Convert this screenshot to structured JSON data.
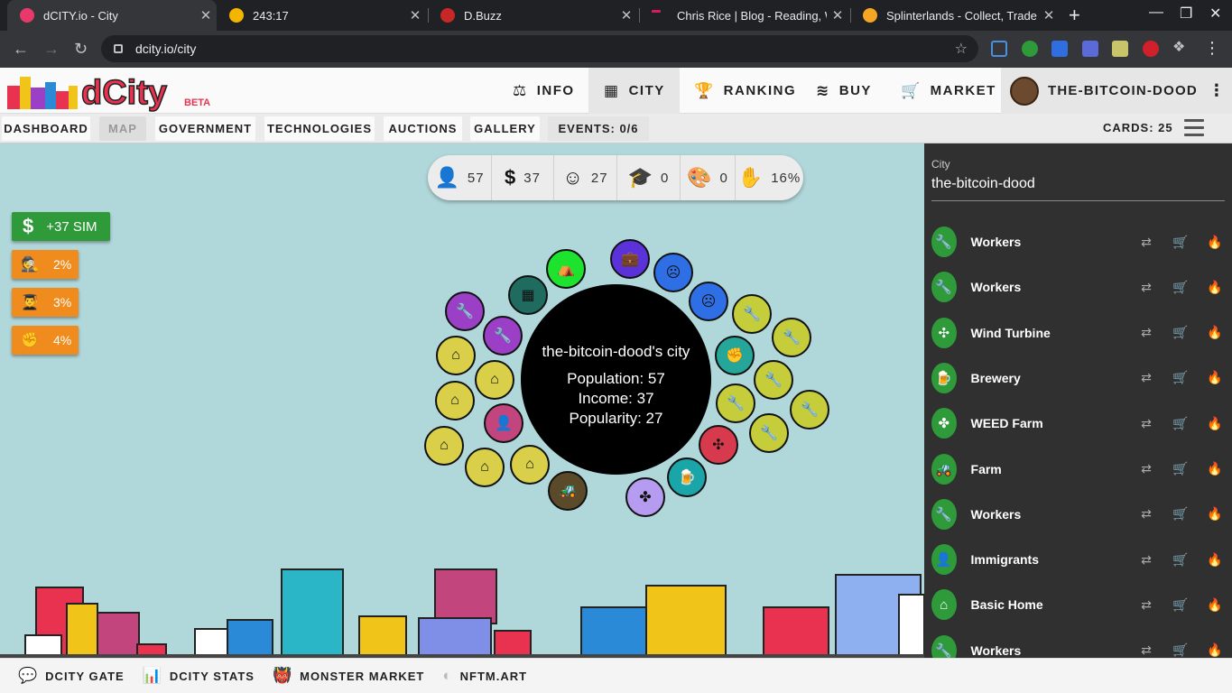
{
  "browser": {
    "tabs": [
      {
        "title": "dCITY.io - City",
        "favicon_color": "#e83a6a"
      },
      {
        "title": "243:17",
        "favicon_color": "#f4b400"
      },
      {
        "title": "D.Buzz",
        "favicon_color": "#c62828"
      },
      {
        "title": "Chris Rice | Blog - Reading, W",
        "favicon_color": "#d81b60"
      },
      {
        "title": "Splinterlands - Collect, Trade,",
        "favicon_color": "#f5a623"
      }
    ],
    "new_tab_glyph": "+",
    "close_glyph": "✕",
    "url": "dcity.io/city",
    "window_controls": [
      "—",
      "❐",
      "✕"
    ]
  },
  "header": {
    "logo_text": "dCity",
    "logo_badge": "BETA",
    "nav": [
      {
        "label": "INFO",
        "icon": "scale-icon",
        "glyph": "⚖"
      },
      {
        "label": "CITY",
        "icon": "city-icon",
        "glyph": "▦"
      },
      {
        "label": "RANKING",
        "icon": "trophy-icon",
        "glyph": "🏆"
      },
      {
        "label": "BUY",
        "icon": "layers-icon",
        "glyph": "≋"
      },
      {
        "label": "MARKET",
        "icon": "cart-icon",
        "glyph": "🛒"
      }
    ],
    "user": "THE-BITCOIN-DOOD",
    "more_glyph": "⋮"
  },
  "subnav": {
    "buttons": [
      "DASHBOARD",
      "MAP",
      "GOVERNMENT",
      "TECHNOLOGIES",
      "AUCTIONS",
      "GALLERY",
      "EVENTS: 0/6"
    ],
    "cards": "CARDS: 25"
  },
  "stats": [
    {
      "icon": "person-icon",
      "glyph": "👤",
      "value": "57"
    },
    {
      "icon": "dollar-icon",
      "glyph": "$",
      "value": "37"
    },
    {
      "icon": "smile-icon",
      "glyph": "☺",
      "value": "27"
    },
    {
      "icon": "graduation-cap-icon",
      "glyph": "🎓",
      "value": "0"
    },
    {
      "icon": "palette-icon",
      "glyph": "🎨",
      "value": "0"
    },
    {
      "icon": "hand-money-icon",
      "glyph": "✋",
      "value": "16%"
    }
  ],
  "left_panel": {
    "sim": {
      "glyph": "$",
      "label": "+37 SIM"
    },
    "percents": [
      {
        "icon": "crime-icon",
        "glyph": "🕵",
        "value": "2%"
      },
      {
        "icon": "education-icon",
        "glyph": "👨‍🎓",
        "value": "3%"
      },
      {
        "icon": "fist-icon",
        "glyph": "✊",
        "value": "4%"
      }
    ]
  },
  "city_core": {
    "title": "the-bitcoin-dood's city",
    "population": "Population: 57",
    "income": "Income: 37",
    "popularity": "Popularity: 27"
  },
  "bubbles": [
    {
      "icon": "wrench-icon",
      "glyph": "🔧",
      "color": "#9b3fc6"
    },
    {
      "icon": "wrench-icon",
      "glyph": "🔧",
      "color": "#9b3fc6"
    },
    {
      "icon": "factory-icon",
      "glyph": "▦",
      "color": "#1f6b60"
    },
    {
      "icon": "camp-icon",
      "glyph": "⛺",
      "color": "#1ee32e"
    },
    {
      "icon": "briefcase-icon",
      "glyph": "💼",
      "color": "#5b32d9"
    },
    {
      "icon": "sad-icon",
      "glyph": "☹",
      "color": "#2e6fe6"
    },
    {
      "icon": "sad-icon",
      "glyph": "☹",
      "color": "#2e6fe6"
    },
    {
      "icon": "wrench-icon",
      "glyph": "🔧",
      "color": "#c6cd3a"
    },
    {
      "icon": "wrench-icon",
      "glyph": "🔧",
      "color": "#c6cd3a"
    },
    {
      "icon": "fist-icon",
      "glyph": "✊",
      "color": "#24a69a"
    },
    {
      "icon": "wrench-icon",
      "glyph": "🔧",
      "color": "#c6cd3a"
    },
    {
      "icon": "wrench-icon",
      "glyph": "🔧",
      "color": "#c6cd3a"
    },
    {
      "icon": "wrench-icon",
      "glyph": "🔧",
      "color": "#c6cd3a"
    },
    {
      "icon": "wrench-icon",
      "glyph": "🔧",
      "color": "#c6cd3a"
    },
    {
      "icon": "pinwheel-icon",
      "glyph": "✣",
      "color": "#d63a4c"
    },
    {
      "icon": "beer-icon",
      "glyph": "🍺",
      "color": "#1aa6a8"
    },
    {
      "icon": "leaf-icon",
      "glyph": "✤",
      "color": "#b59cf0"
    },
    {
      "icon": "tractor-icon",
      "glyph": "🚜",
      "color": "#5a4a2a"
    },
    {
      "icon": "house-icon",
      "glyph": "⌂",
      "color": "#d9cf48"
    },
    {
      "icon": "house-icon",
      "glyph": "⌂",
      "color": "#d9cf48"
    },
    {
      "icon": "house-icon",
      "glyph": "⌂",
      "color": "#d9cf48"
    },
    {
      "icon": "house-icon",
      "glyph": "⌂",
      "color": "#d9cf48"
    },
    {
      "icon": "house-icon",
      "glyph": "⌂",
      "color": "#d9cf48"
    },
    {
      "icon": "house-icon",
      "glyph": "⌂",
      "color": "#d9cf48"
    },
    {
      "icon": "immigrant-icon",
      "glyph": "👤",
      "color": "#c2457d"
    }
  ],
  "sidebar": {
    "label": "City",
    "value": "the-bitcoin-dood",
    "items": [
      {
        "name": "Workers",
        "icon": "wrench-icon",
        "glyph": "🔧"
      },
      {
        "name": "Workers",
        "icon": "wrench-icon",
        "glyph": "🔧"
      },
      {
        "name": "Wind Turbine",
        "icon": "pinwheel-icon",
        "glyph": "✣"
      },
      {
        "name": "Brewery",
        "icon": "beer-icon",
        "glyph": "🍺"
      },
      {
        "name": "WEED Farm",
        "icon": "leaf-icon",
        "glyph": "✤"
      },
      {
        "name": "Farm",
        "icon": "tractor-icon",
        "glyph": "🚜"
      },
      {
        "name": "Workers",
        "icon": "wrench-icon",
        "glyph": "🔧"
      },
      {
        "name": "Immigrants",
        "icon": "immigrant-icon",
        "glyph": "👤"
      },
      {
        "name": "Basic Home",
        "icon": "house-icon",
        "glyph": "⌂"
      },
      {
        "name": "Workers",
        "icon": "wrench-icon",
        "glyph": "🔧"
      }
    ],
    "actions": [
      {
        "icon": "transfer-icon",
        "glyph": "⇄"
      },
      {
        "icon": "cart-icon",
        "glyph": "🛒"
      },
      {
        "icon": "burn-icon",
        "glyph": "🔥"
      }
    ]
  },
  "footer": [
    {
      "label": "DCITY GATE",
      "icon": "discord-icon",
      "glyph": "💬"
    },
    {
      "label": "DCITY STATS",
      "icon": "bar-chart-icon",
      "glyph": "📊"
    },
    {
      "label": "MONSTER MARKET",
      "icon": "monster-icon",
      "glyph": "👹"
    },
    {
      "label": "NFTM.ART",
      "icon": "nftm-icon",
      "glyph": "◐"
    }
  ]
}
